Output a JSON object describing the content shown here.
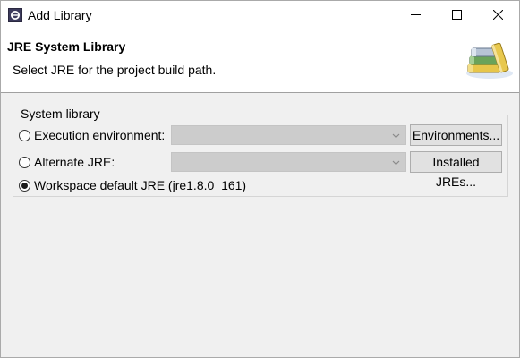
{
  "window": {
    "title": "Add Library",
    "controls": [
      "minimize-icon",
      "maximize-icon",
      "close-icon"
    ]
  },
  "header": {
    "title": "JRE System Library",
    "description": "Select JRE for the project build path."
  },
  "group": {
    "label": "System library",
    "options": [
      {
        "label": "Execution environment:",
        "selected": false,
        "combo_value": "",
        "button": "Environments..."
      },
      {
        "label": "Alternate JRE:",
        "selected": false,
        "combo_value": "",
        "button": "Installed JREs..."
      },
      {
        "label": "Workspace default JRE (jre1.8.0_161)",
        "selected": true
      }
    ]
  },
  "colors": {
    "header_bg": "#ffffff",
    "dialog_bg": "#f0f0f0",
    "combo_disabled_bg": "#cccccc",
    "button_bg": "#e1e1e1"
  }
}
